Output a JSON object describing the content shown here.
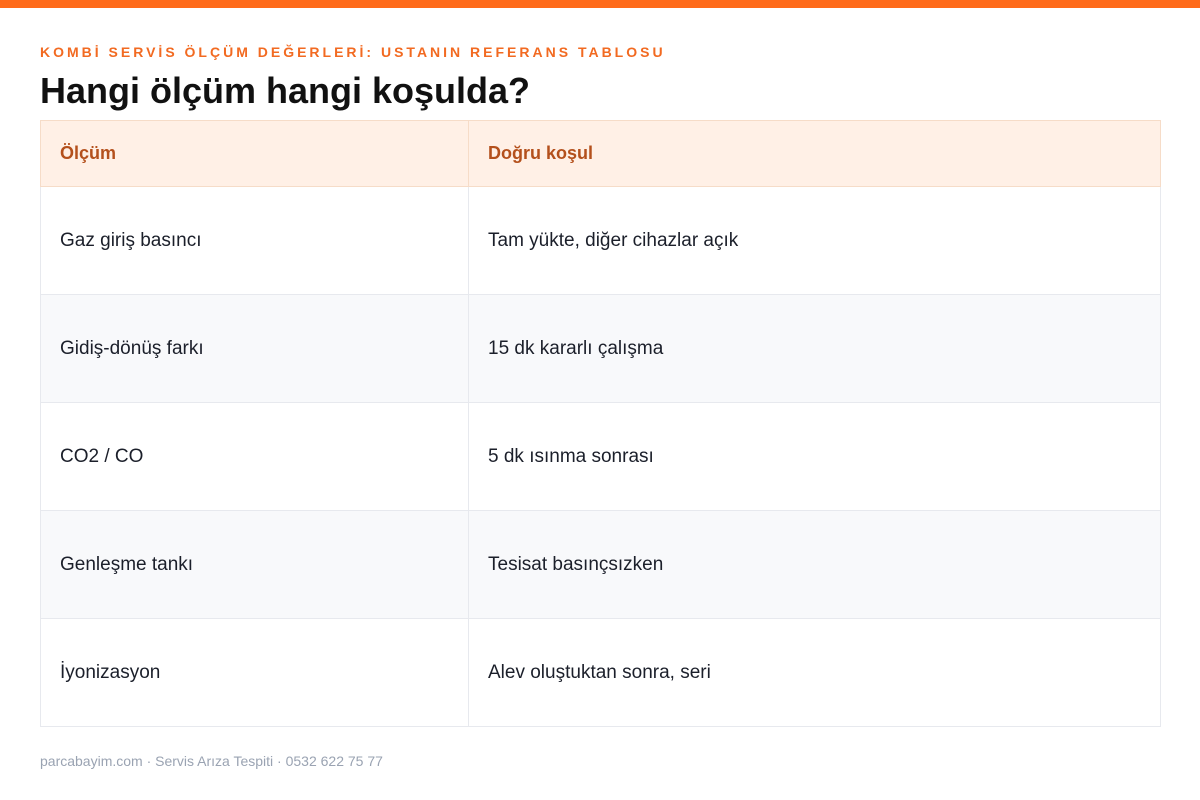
{
  "eyebrow": "KOMBİ SERVİS ÖLÇÜM DEĞERLERİ: USTANIN REFERANS TABLOSU",
  "title": "Hangi ölçüm hangi koşulda?",
  "table": {
    "headers": [
      "Ölçüm",
      "Doğru koşul"
    ],
    "rows": [
      [
        "Gaz giriş basıncı",
        "Tam yükte, diğer cihazlar açık"
      ],
      [
        "Gidiş-dönüş farkı",
        "15 dk kararlı çalışma"
      ],
      [
        "CO2 / CO",
        "5 dk ısınma sonrası"
      ],
      [
        "Genleşme tankı",
        "Tesisat basınçsızken"
      ],
      [
        "İyonizasyon",
        "Alev oluştuktan sonra, seri"
      ]
    ]
  },
  "footer": "parcabayim.com · Servis Arıza Tespiti · 0532 622 75 77",
  "colors": {
    "accent": "#ff6b1a",
    "header_bg": "#fff0e6",
    "header_text": "#b4501c"
  }
}
